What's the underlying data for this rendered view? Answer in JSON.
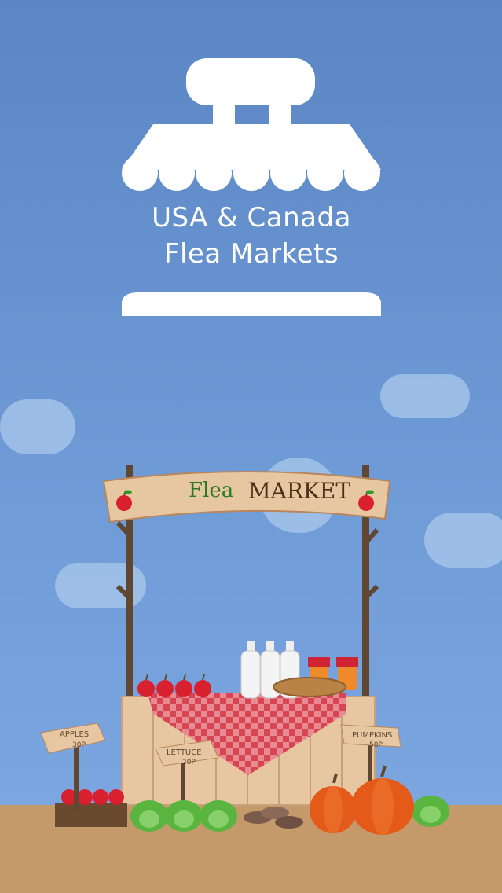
{
  "app": {
    "logo_line1": "USA & Canada",
    "logo_line2": "Flea Markets"
  },
  "sign": {
    "word_flea": "Flea",
    "word_market": "MARKET"
  },
  "tags": {
    "apples": "APPLES",
    "apples_price": "30P",
    "lettuce": "LETTUCE",
    "lettuce_price": "20P",
    "pumpkins": "PUMPKINS",
    "pumpkins_price": "50P"
  },
  "colors": {
    "sky": "#5b86c4",
    "cloud": "#a9c8ec",
    "ground": "#c59a6a",
    "wood": "#e7c7a2",
    "post": "#5f4732",
    "check_red": "#cf2433",
    "flea_green": "#2d7a22",
    "market_brown": "#4b2e16",
    "apple": "#d8202e",
    "pumpkin": "#e45a18",
    "cabbage": "#5ab540"
  },
  "icons": {
    "logo": "market-stall-icon",
    "apple": "apple-icon",
    "pumpkin": "pumpkin-icon",
    "cabbage": "cabbage-icon",
    "bottle": "milk-bottle-icon",
    "jar": "jar-icon",
    "bread": "bread-icon"
  }
}
